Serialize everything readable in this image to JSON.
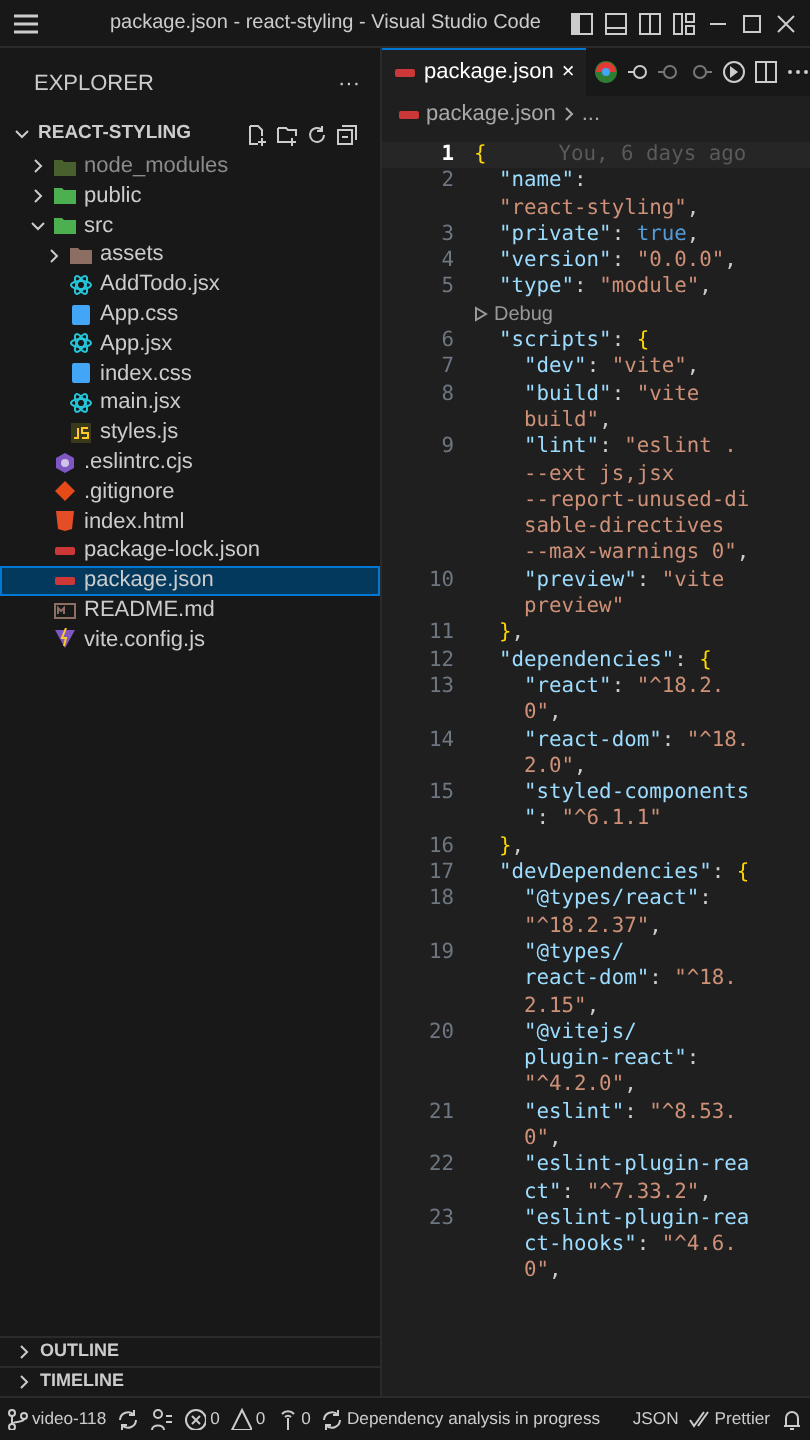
{
  "window": {
    "title": "package.json - react-styling - Visual Studio Code"
  },
  "sidebar": {
    "title": "EXPLORER",
    "more": "···",
    "folder": "REACT-STYLING",
    "folder_expanded": true,
    "tree": [
      {
        "label": "node_modules",
        "kind": "nodefolder",
        "expanded": false,
        "dimmed": true,
        "selected": false
      },
      {
        "label": "public",
        "kind": "folder",
        "expanded": false,
        "dimmed": false,
        "selected": false
      },
      {
        "label": "src",
        "kind": "folder",
        "expanded": true,
        "dimmed": false,
        "selected": false,
        "children": [
          {
            "label": "assets",
            "kind": "assetfolder",
            "expanded": false,
            "dimmed": false,
            "selected": false
          },
          {
            "label": "AddTodo.jsx",
            "kind": "react",
            "dimmed": false,
            "selected": false
          },
          {
            "label": "App.css",
            "kind": "css",
            "dimmed": false,
            "selected": false
          },
          {
            "label": "App.jsx",
            "kind": "react",
            "dimmed": false,
            "selected": false
          },
          {
            "label": "index.css",
            "kind": "css",
            "dimmed": false,
            "selected": false
          },
          {
            "label": "main.jsx",
            "kind": "react",
            "dimmed": false,
            "selected": false
          },
          {
            "label": "styles.js",
            "kind": "js",
            "dimmed": false,
            "selected": false
          }
        ]
      },
      {
        "label": ".eslintrc.cjs",
        "kind": "eslint",
        "dimmed": false,
        "selected": false
      },
      {
        "label": ".gitignore",
        "kind": "git",
        "dimmed": false,
        "selected": false
      },
      {
        "label": "index.html",
        "kind": "html",
        "dimmed": false,
        "selected": false
      },
      {
        "label": "package-lock.json",
        "kind": "json",
        "dimmed": false,
        "selected": false
      },
      {
        "label": "package.json",
        "kind": "json",
        "dimmed": false,
        "selected": true
      },
      {
        "label": "README.md",
        "kind": "md",
        "dimmed": false,
        "selected": false
      },
      {
        "label": "vite.config.js",
        "kind": "vite",
        "dimmed": false,
        "selected": false
      }
    ],
    "panels": [
      {
        "label": "OUTLINE",
        "expanded": false
      },
      {
        "label": "TIMELINE",
        "expanded": false
      }
    ]
  },
  "tabs": [
    {
      "label": "package.json",
      "selected": true,
      "close": "×"
    }
  ],
  "breadcrumb": [
    "package.json",
    "..."
  ],
  "editor": {
    "rows": [
      {
        "num": "1",
        "active": true,
        "tokens": [
          {
            "kind": "brace",
            "text": "{"
          }
        ],
        "blame": "You, 6 days ago"
      },
      {
        "num": "2",
        "active": false,
        "tokens": [
          {
            "kind": "key",
            "text": "  \"name\""
          },
          {
            "kind": "punct",
            "text": ":"
          }
        ]
      },
      {
        "tokens": [
          {
            "kind": "str",
            "text": "  \"react-styling\""
          },
          {
            "kind": "punct",
            "text": ","
          }
        ]
      },
      {
        "num": "3",
        "active": false,
        "tokens": [
          {
            "kind": "key",
            "text": "  \"private\""
          },
          {
            "kind": "punct",
            "text": ": "
          },
          {
            "kind": "bool",
            "text": "true"
          },
          {
            "kind": "punct",
            "text": ","
          }
        ]
      },
      {
        "num": "4",
        "active": false,
        "tokens": [
          {
            "kind": "key",
            "text": "  \"version\""
          },
          {
            "kind": "punct",
            "text": ": "
          },
          {
            "kind": "str",
            "text": "\"0.0.0\""
          },
          {
            "kind": "punct",
            "text": ","
          }
        ]
      },
      {
        "num": "5",
        "active": false,
        "tokens": [
          {
            "kind": "key",
            "text": "  \"type\""
          },
          {
            "kind": "punct",
            "text": ": "
          },
          {
            "kind": "str",
            "text": "\"module\""
          },
          {
            "kind": "punct",
            "text": ","
          }
        ]
      },
      {
        "lens": "Debug",
        "tokens": []
      },
      {
        "num": "6",
        "active": false,
        "tokens": [
          {
            "kind": "key",
            "text": "  \"scripts\""
          },
          {
            "kind": "punct",
            "text": ": "
          },
          {
            "kind": "brace",
            "text": "{"
          }
        ]
      },
      {
        "num": "7",
        "active": false,
        "tokens": [
          {
            "kind": "key",
            "text": "    \"dev\""
          },
          {
            "kind": "punct",
            "text": ": "
          },
          {
            "kind": "str",
            "text": "\"vite\""
          },
          {
            "kind": "punct",
            "text": ","
          }
        ]
      },
      {
        "num": "8",
        "active": false,
        "tokens": [
          {
            "kind": "key",
            "text": "    \"build\""
          },
          {
            "kind": "punct",
            "text": ": "
          },
          {
            "kind": "str",
            "text": "\"vite"
          }
        ]
      },
      {
        "tokens": [
          {
            "kind": "str",
            "text": "    build\""
          },
          {
            "kind": "punct",
            "text": ","
          }
        ]
      },
      {
        "num": "9",
        "active": false,
        "tokens": [
          {
            "kind": "key",
            "text": "    \"lint\""
          },
          {
            "kind": "punct",
            "text": ": "
          },
          {
            "kind": "str",
            "text": "\"eslint ."
          }
        ]
      },
      {
        "tokens": [
          {
            "kind": "str",
            "text": "    --ext js,jsx"
          }
        ]
      },
      {
        "tokens": [
          {
            "kind": "str",
            "text": "    --report-unused-di"
          }
        ]
      },
      {
        "tokens": [
          {
            "kind": "str",
            "text": "    sable-directives"
          }
        ]
      },
      {
        "tokens": [
          {
            "kind": "str",
            "text": "    --max-warnings 0\""
          },
          {
            "kind": "punct",
            "text": ","
          }
        ]
      },
      {
        "num": "10",
        "active": false,
        "tokens": [
          {
            "kind": "key",
            "text": "    \"preview\""
          },
          {
            "kind": "punct",
            "text": ": "
          },
          {
            "kind": "str",
            "text": "\"vite"
          }
        ]
      },
      {
        "tokens": [
          {
            "kind": "str",
            "text": "    preview\""
          }
        ]
      },
      {
        "num": "11",
        "active": false,
        "tokens": [
          {
            "kind": "brace",
            "text": "  }"
          },
          {
            "kind": "punct",
            "text": ","
          }
        ]
      },
      {
        "num": "12",
        "active": false,
        "tokens": [
          {
            "kind": "key",
            "text": "  \"dependencies\""
          },
          {
            "kind": "punct",
            "text": ": "
          },
          {
            "kind": "brace",
            "text": "{"
          }
        ]
      },
      {
        "num": "13",
        "active": false,
        "tokens": [
          {
            "kind": "key",
            "text": "    \"react\""
          },
          {
            "kind": "punct",
            "text": ": "
          },
          {
            "kind": "str",
            "text": "\"^18.2."
          }
        ]
      },
      {
        "tokens": [
          {
            "kind": "str",
            "text": "    0\""
          },
          {
            "kind": "punct",
            "text": ","
          }
        ]
      },
      {
        "num": "14",
        "active": false,
        "tokens": [
          {
            "kind": "key",
            "text": "    \"react-dom\""
          },
          {
            "kind": "punct",
            "text": ": "
          },
          {
            "kind": "str",
            "text": "\"^18."
          }
        ]
      },
      {
        "tokens": [
          {
            "kind": "str",
            "text": "    2.0\""
          },
          {
            "kind": "punct",
            "text": ","
          }
        ]
      },
      {
        "num": "15",
        "active": false,
        "tokens": [
          {
            "kind": "key",
            "text": "    \"styled-components"
          }
        ]
      },
      {
        "tokens": [
          {
            "kind": "key",
            "text": "    \""
          },
          {
            "kind": "punct",
            "text": ": "
          },
          {
            "kind": "str",
            "text": "\"^6.1.1\""
          }
        ]
      },
      {
        "num": "16",
        "active": false,
        "tokens": [
          {
            "kind": "brace",
            "text": "  }"
          },
          {
            "kind": "punct",
            "text": ","
          }
        ]
      },
      {
        "num": "17",
        "active": false,
        "tokens": [
          {
            "kind": "key",
            "text": "  \"devDependencies\""
          },
          {
            "kind": "punct",
            "text": ": "
          },
          {
            "kind": "brace",
            "text": "{"
          }
        ]
      },
      {
        "num": "18",
        "active": false,
        "tokens": [
          {
            "kind": "key",
            "text": "    \"@types/react\""
          },
          {
            "kind": "punct",
            "text": ":"
          }
        ]
      },
      {
        "tokens": [
          {
            "kind": "str",
            "text": "    \"^18.2.37\""
          },
          {
            "kind": "punct",
            "text": ","
          }
        ]
      },
      {
        "num": "19",
        "active": false,
        "tokens": [
          {
            "kind": "key",
            "text": "    \"@types/"
          }
        ]
      },
      {
        "tokens": [
          {
            "kind": "key",
            "text": "    react-dom\""
          },
          {
            "kind": "punct",
            "text": ": "
          },
          {
            "kind": "str",
            "text": "\"^18."
          }
        ]
      },
      {
        "tokens": [
          {
            "kind": "str",
            "text": "    2.15\""
          },
          {
            "kind": "punct",
            "text": ","
          }
        ]
      },
      {
        "num": "20",
        "active": false,
        "tokens": [
          {
            "kind": "key",
            "text": "    \"@vitejs/"
          }
        ]
      },
      {
        "tokens": [
          {
            "kind": "key",
            "text": "    plugin-react\""
          },
          {
            "kind": "punct",
            "text": ":"
          }
        ]
      },
      {
        "tokens": [
          {
            "kind": "str",
            "text": "    \"^4.2.0\""
          },
          {
            "kind": "punct",
            "text": ","
          }
        ]
      },
      {
        "num": "21",
        "active": false,
        "tokens": [
          {
            "kind": "key",
            "text": "    \"eslint\""
          },
          {
            "kind": "punct",
            "text": ": "
          },
          {
            "kind": "str",
            "text": "\"^8.53."
          }
        ]
      },
      {
        "tokens": [
          {
            "kind": "str",
            "text": "    0\""
          },
          {
            "kind": "punct",
            "text": ","
          }
        ]
      },
      {
        "num": "22",
        "active": false,
        "tokens": [
          {
            "kind": "key",
            "text": "    \"eslint-plugin-rea"
          }
        ]
      },
      {
        "tokens": [
          {
            "kind": "key",
            "text": "    ct\""
          },
          {
            "kind": "punct",
            "text": ": "
          },
          {
            "kind": "str",
            "text": "\"^7.33.2\""
          },
          {
            "kind": "punct",
            "text": ","
          }
        ]
      },
      {
        "num": "23",
        "active": false,
        "tokens": [
          {
            "kind": "key",
            "text": "    \"eslint-plugin-rea"
          }
        ]
      },
      {
        "tokens": [
          {
            "kind": "key",
            "text": "    ct-hooks\""
          },
          {
            "kind": "punct",
            "text": ": "
          },
          {
            "kind": "str",
            "text": "\"^4.6."
          }
        ]
      },
      {
        "tokens": [
          {
            "kind": "str",
            "text": "    0\""
          },
          {
            "kind": "punct",
            "text": ","
          }
        ]
      }
    ]
  },
  "status_bar": [
    {
      "kind": "branch",
      "text": "video-118"
    },
    {
      "kind": "sync"
    },
    {
      "kind": "account"
    },
    {
      "kind": "errors",
      "text": "0"
    },
    {
      "kind": "warnings",
      "text": "0"
    },
    {
      "kind": "ports",
      "text": "0"
    },
    {
      "kind": "progress",
      "text": "Dependency analysis in progress"
    },
    {
      "kind": "plain",
      "text": "JSON"
    },
    {
      "kind": "prettier",
      "text": "Prettier"
    },
    {
      "kind": "bell"
    }
  ]
}
